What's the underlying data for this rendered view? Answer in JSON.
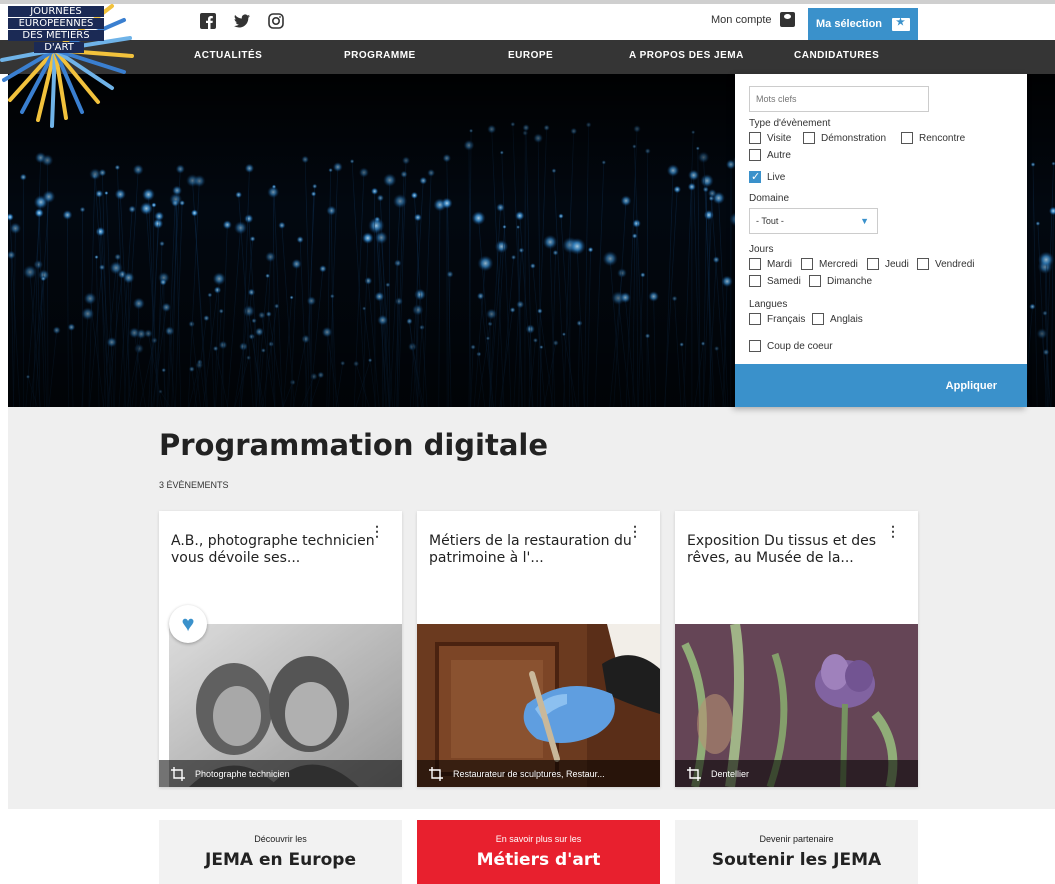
{
  "logo": {
    "lines": [
      "JOURNÉES",
      "EUROPÉENNES",
      "DES MÉTIERS",
      "D'ART"
    ]
  },
  "social": {
    "icons": [
      "facebook-icon",
      "twitter-icon",
      "instagram-icon"
    ]
  },
  "header": {
    "account_label": "Mon compte",
    "selection_label": "Ma sélection"
  },
  "nav": {
    "items": [
      "ACTUALITÉS",
      "PROGRAMME",
      "EUROPE",
      "A PROPOS DES JEMA",
      "CANDIDATURES"
    ]
  },
  "filter": {
    "keywords_placeholder": "Mots clefs",
    "event_type_label": "Type d'évènement",
    "event_types": [
      {
        "label": "Visite",
        "checked": false
      },
      {
        "label": "Démonstration",
        "checked": false
      },
      {
        "label": "Rencontre",
        "checked": false
      },
      {
        "label": "Autre",
        "checked": false
      },
      {
        "label": "Live",
        "checked": true
      }
    ],
    "domain_label": "Domaine",
    "domain_value": "- Tout -",
    "days_label": "Jours",
    "days": [
      "Mardi",
      "Mercredi",
      "Jeudi",
      "Vendredi",
      "Samedi",
      "Dimanche"
    ],
    "languages_label": "Langues",
    "languages": [
      "Français",
      "Anglais"
    ],
    "favorite_label": "Coup de coeur",
    "apply_label": "Appliquer"
  },
  "main": {
    "title": "Programmation digitale",
    "count": "3 ÉVÈNEMENTS"
  },
  "cards": [
    {
      "title": "A.B., photographe technicien vous dévoile ses...",
      "tag": "Photographe technicien",
      "favorited": true
    },
    {
      "title": "Métiers de la restauration du patrimoine à l'...",
      "tag": "Restaurateur de sculptures, Restaur...",
      "favorited": false
    },
    {
      "title": "Exposition Du tissus et des rêves, au Musée de la...",
      "tag": "Dentellier",
      "favorited": false
    }
  ],
  "promos": [
    {
      "small": "Découvrir les",
      "big": "JEMA en Europe",
      "bg": "#f2f2f2",
      "color": "#222222"
    },
    {
      "small": "En savoir plus sur les",
      "big": "Métiers d'art",
      "bg": "#e8202e",
      "color": "#ffffff"
    },
    {
      "small": "Devenir partenaire",
      "big": "Soutenir les JEMA",
      "bg": "#f2f2f2",
      "color": "#222222"
    }
  ],
  "colors": {
    "accent": "#3a91cb",
    "nav_bg": "#353535",
    "promo_red": "#e8202e"
  }
}
